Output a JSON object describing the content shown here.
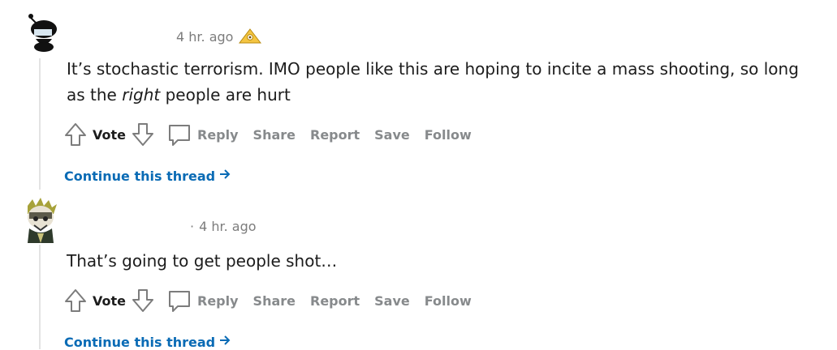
{
  "comments": [
    {
      "timestamp": "4 hr. ago",
      "award_icon": "helpful-award-icon",
      "text_before": "It’s stochastic terrorism. IMO people like this are hoping to incite a mass shooting, so long as the ",
      "text_em": "right",
      "text_after": " people are hurt",
      "actions": {
        "vote": "Vote",
        "reply": "Reply",
        "share": "Share",
        "report": "Report",
        "save": "Save",
        "follow": "Follow"
      },
      "continue": "Continue this thread"
    },
    {
      "separator": "·",
      "timestamp": "4 hr. ago",
      "text": "That’s going to get people shot…",
      "actions": {
        "vote": "Vote",
        "reply": "Reply",
        "share": "Share",
        "report": "Report",
        "save": "Save",
        "follow": "Follow"
      },
      "continue": "Continue this thread"
    }
  ],
  "colors": {
    "link": "#0a6bb5",
    "muted": "#878a8c",
    "thread_line": "#e3e3e3"
  }
}
